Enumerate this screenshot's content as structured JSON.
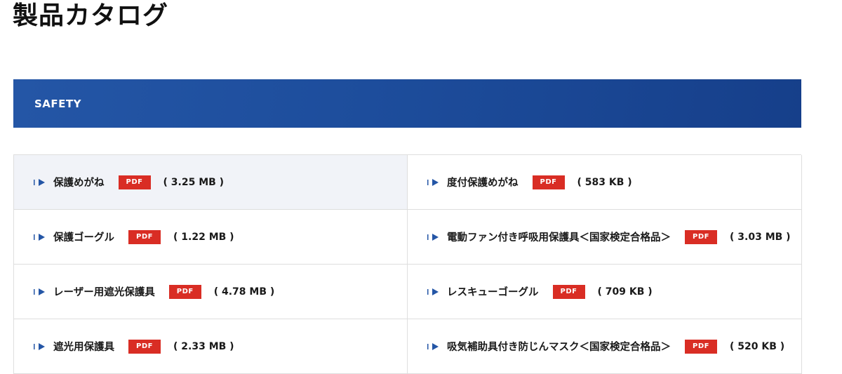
{
  "page": {
    "title": "製品カタログ"
  },
  "section": {
    "heading": "SAFETY"
  },
  "catalog": {
    "items": [
      {
        "name": "保護めがね",
        "badge": "PDF",
        "size": "( 3.25 MB )"
      },
      {
        "name": "度付保護めがね",
        "badge": "PDF",
        "size": "( 583 KB )"
      },
      {
        "name": "保護ゴーグル",
        "badge": "PDF",
        "size": "( 1.22 MB )"
      },
      {
        "name": "電動ファン付き呼吸用保護具＜国家検定合格品＞",
        "badge": "PDF",
        "size": "( 3.03 MB )"
      },
      {
        "name": "レーザー用遮光保護具",
        "badge": "PDF",
        "size": "( 4.78 MB )"
      },
      {
        "name": "レスキューゴーグル",
        "badge": "PDF",
        "size": "( 709 KB )"
      },
      {
        "name": "遮光用保護具",
        "badge": "PDF",
        "size": "( 2.33 MB )"
      },
      {
        "name": "吸気補助具付き防じんマスク＜国家検定合格品＞",
        "badge": "PDF",
        "size": "( 520 KB )"
      }
    ]
  },
  "colors": {
    "header_start": "#2456a6",
    "header_end": "#163f8a",
    "pdf_badge": "#d92d24",
    "arrow": "#2456a6",
    "highlight_row": "#f1f3f8"
  },
  "icons": {
    "item_marker": "arrow-right-icon"
  }
}
